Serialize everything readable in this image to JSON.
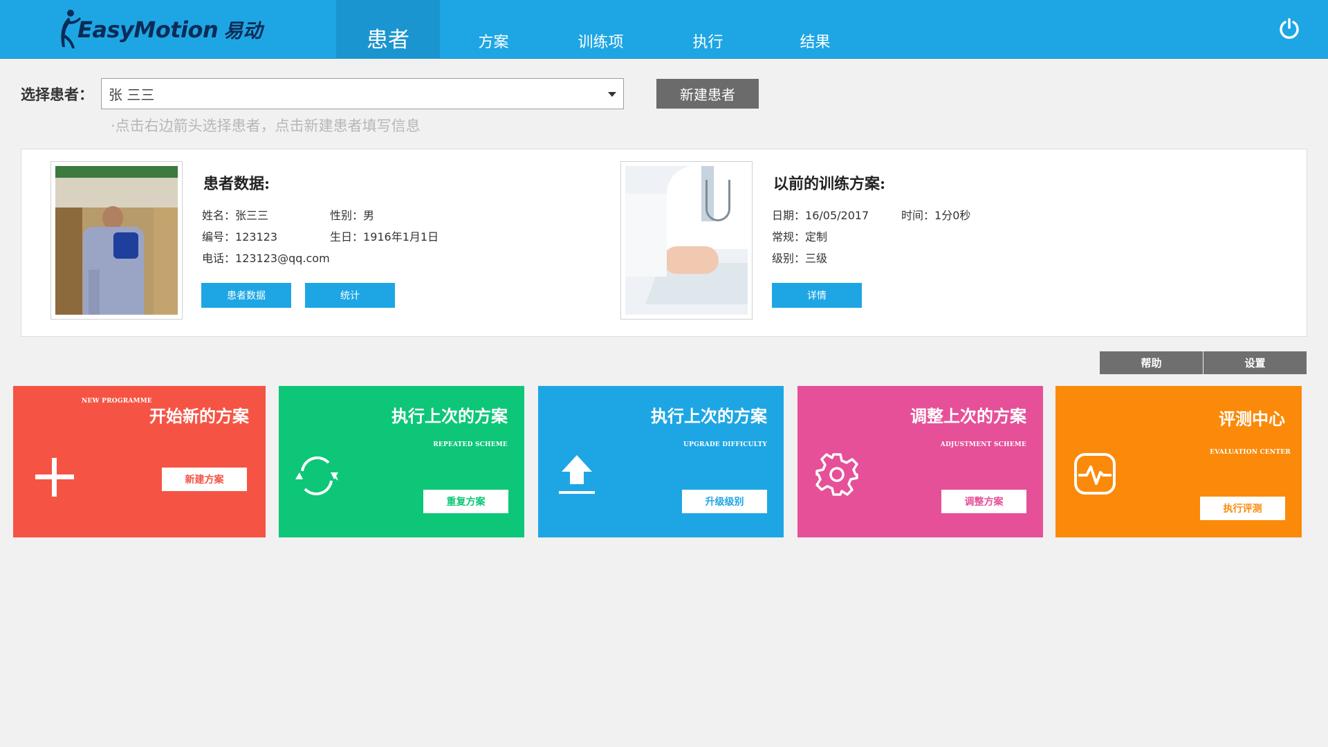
{
  "header": {
    "logo_text": "EasyMotion",
    "logo_cn": "易动",
    "tabs": [
      {
        "label": "患者",
        "active": true
      },
      {
        "label": "方案",
        "active": false
      },
      {
        "label": "训练项",
        "active": false
      },
      {
        "label": "执行",
        "active": false
      },
      {
        "label": "结果",
        "active": false
      }
    ],
    "power_icon": "power-icon"
  },
  "patient_select": {
    "label": "选择患者：",
    "value": "张 三三",
    "hint": "·点击右边箭头选择患者，点击新建患者填写信息",
    "new_patient_button": "新建患者"
  },
  "patient_info": {
    "title": "患者数据:",
    "name_key": "姓名：",
    "name": "张三三",
    "gender_key": "性别：",
    "gender": "男",
    "id_key": "编号：",
    "id": "123123",
    "birthday_key": "生日：",
    "birthday": "1916年1月1日",
    "phone_key": "电话：",
    "phone": "123123@qq.com",
    "data_button": "患者数据",
    "stats_button": "统计"
  },
  "previous_plan": {
    "title": "以前的训练方案:",
    "date_key": "日期：",
    "date": "16/05/2017",
    "time_key": "时间：",
    "time": "1分0秒",
    "routine_key": "常规：",
    "routine": "定制",
    "level_key": "级别：",
    "level": "三级",
    "detail_button": "详情"
  },
  "utility": {
    "help": "帮助",
    "settings": "设置"
  },
  "tiles": [
    {
      "title": "开始新的方案",
      "sub": "NEW PROGRAMME",
      "button": "新建方案",
      "color": "#f55444",
      "icon": "plus-icon"
    },
    {
      "title": "执行上次的方案",
      "sub": "REPEATED SCHEME",
      "button": "重复方案",
      "color": "#0ec678",
      "icon": "refresh-icon"
    },
    {
      "title": "执行上次的方案",
      "sub": "UPGRADE DIFFICULTY",
      "button": "升级级别",
      "color": "#1ea6e4",
      "icon": "upload-icon"
    },
    {
      "title": "调整上次的方案",
      "sub": "ADJUSTMENT SCHEME",
      "button": "调整方案",
      "color": "#e65098",
      "icon": "gear-icon"
    },
    {
      "title": "评测中心",
      "sub": "EVALUATION CENTER",
      "button": "执行评测",
      "color": "#fb8a0a",
      "icon": "heartbeat-icon"
    }
  ]
}
